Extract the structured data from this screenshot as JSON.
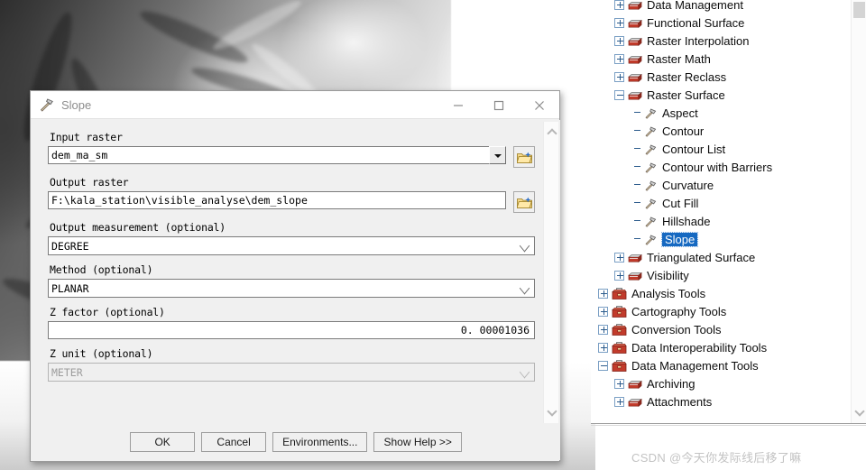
{
  "dialog": {
    "title": "Slope",
    "title_icon": "hammer-tool-icon",
    "window_buttons": {
      "minimize": "—",
      "maximize": "☐",
      "close": "✕"
    },
    "fields": [
      {
        "label": "Input raster",
        "value": "dem_ma_sm",
        "kind": "combo95",
        "browse": true,
        "disabled": false
      },
      {
        "label": "Output raster",
        "value": "F:\\kala_station\\visible_analyse\\dem_slope",
        "kind": "text",
        "browse": true,
        "disabled": false
      },
      {
        "label": "Output measurement (optional)",
        "value": "DEGREE",
        "kind": "dropdown",
        "browse": false,
        "disabled": false
      },
      {
        "label": "Method (optional)",
        "value": "PLANAR",
        "kind": "dropdown",
        "browse": false,
        "disabled": false
      },
      {
        "label": "Z factor (optional)",
        "value": "0. 00001036",
        "kind": "number",
        "browse": false,
        "disabled": false
      },
      {
        "label": "Z unit (optional)",
        "value": "METER",
        "kind": "dropdown",
        "browse": false,
        "disabled": true
      }
    ],
    "buttons": [
      {
        "label": "OK",
        "name": "ok-button"
      },
      {
        "label": "Cancel",
        "name": "cancel-button"
      },
      {
        "label": "Environments...",
        "name": "environments-button"
      },
      {
        "label": "Show Help >>",
        "name": "show-help-button"
      }
    ],
    "scrollbar": {
      "up": "chevron-up-icon",
      "down": "chevron-down-icon"
    }
  },
  "toolbox": {
    "scrollbar": {
      "up": "scroll-thumb",
      "down": "chevron-down-icon"
    },
    "nodes": [
      {
        "label": "Data Management",
        "indent": 1,
        "expander": "plus",
        "icon": "toolset",
        "selected": false
      },
      {
        "label": "Functional Surface",
        "indent": 1,
        "expander": "plus",
        "icon": "toolset",
        "selected": false
      },
      {
        "label": "Raster Interpolation",
        "indent": 1,
        "expander": "plus",
        "icon": "toolset",
        "selected": false
      },
      {
        "label": "Raster Math",
        "indent": 1,
        "expander": "plus",
        "icon": "toolset",
        "selected": false
      },
      {
        "label": "Raster Reclass",
        "indent": 1,
        "expander": "plus",
        "icon": "toolset",
        "selected": false
      },
      {
        "label": "Raster Surface",
        "indent": 1,
        "expander": "minus",
        "icon": "toolset",
        "selected": false
      },
      {
        "label": "Aspect",
        "indent": 2,
        "expander": "none",
        "icon": "tool",
        "selected": false
      },
      {
        "label": "Contour",
        "indent": 2,
        "expander": "none",
        "icon": "tool",
        "selected": false
      },
      {
        "label": "Contour List",
        "indent": 2,
        "expander": "none",
        "icon": "tool",
        "selected": false
      },
      {
        "label": "Contour with Barriers",
        "indent": 2,
        "expander": "none",
        "icon": "tool",
        "selected": false
      },
      {
        "label": "Curvature",
        "indent": 2,
        "expander": "none",
        "icon": "tool",
        "selected": false
      },
      {
        "label": "Cut Fill",
        "indent": 2,
        "expander": "none",
        "icon": "tool",
        "selected": false
      },
      {
        "label": "Hillshade",
        "indent": 2,
        "expander": "none",
        "icon": "tool",
        "selected": false
      },
      {
        "label": "Slope",
        "indent": 2,
        "expander": "none",
        "icon": "tool",
        "selected": true
      },
      {
        "label": "Triangulated Surface",
        "indent": 1,
        "expander": "plus",
        "icon": "toolset",
        "selected": false
      },
      {
        "label": "Visibility",
        "indent": 1,
        "expander": "plus",
        "icon": "toolset",
        "selected": false
      },
      {
        "label": "Analysis Tools",
        "indent": 0,
        "expander": "plus",
        "icon": "toolbox",
        "selected": false
      },
      {
        "label": "Cartography Tools",
        "indent": 0,
        "expander": "plus",
        "icon": "toolbox",
        "selected": false
      },
      {
        "label": "Conversion Tools",
        "indent": 0,
        "expander": "plus",
        "icon": "toolbox",
        "selected": false
      },
      {
        "label": "Data Interoperability Tools",
        "indent": 0,
        "expander": "plus",
        "icon": "toolbox",
        "selected": false
      },
      {
        "label": "Data Management Tools",
        "indent": 0,
        "expander": "minus",
        "icon": "toolbox",
        "selected": false
      },
      {
        "label": "Archiving",
        "indent": 1,
        "expander": "plus",
        "icon": "toolset",
        "selected": false
      },
      {
        "label": "Attachments",
        "indent": 1,
        "expander": "plus",
        "icon": "toolset",
        "selected": false
      }
    ]
  },
  "watermark": "CSDN @今天你发际线后移了嘛",
  "colors": {
    "selection_blue": "#1669c1",
    "toolbox_red": "#c23b2b",
    "folder_yellow": "#f2c council"
  }
}
